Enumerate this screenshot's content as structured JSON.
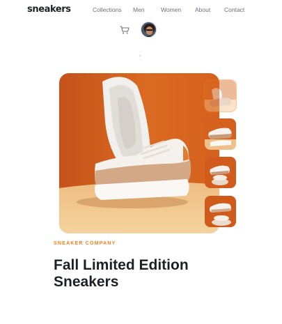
{
  "brand": {
    "logo": "sneakers"
  },
  "nav": {
    "items": [
      "Collections",
      "Men",
      "Women",
      "About",
      "Contact"
    ]
  },
  "header": {
    "cart_icon": "cart-icon",
    "avatar_icon": "user-avatar"
  },
  "colors": {
    "accent": "#ff7d1a",
    "dark": "#1d2026",
    "muted": "#69707d",
    "hero_bg": "#d9631e"
  },
  "gallery": {
    "main_image": "sneaker-photo",
    "thumbnails": [
      "sneaker-thumb-1",
      "sneaker-thumb-2",
      "sneaker-thumb-3",
      "sneaker-thumb-4"
    ],
    "selected_thumbnail": 1
  },
  "product": {
    "company": "SNEAKER COMPANY",
    "name": "Fall Limited Edition Sneakers"
  }
}
